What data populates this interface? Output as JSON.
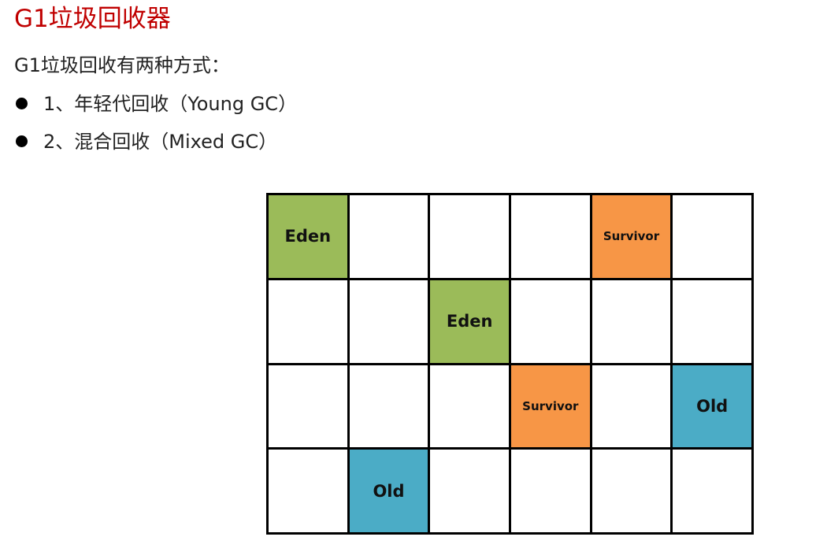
{
  "title": "G1垃圾回收器",
  "intro": "G1垃圾回收有两种方式：",
  "bullets": [
    "1、年轻代回收（Young GC）",
    "2、混合回收（Mixed GC）"
  ],
  "grid": {
    "rows": 4,
    "cols": 6,
    "cells": [
      [
        "Eden",
        "",
        "",
        "",
        "Survivor",
        ""
      ],
      [
        "",
        "",
        "Eden",
        "",
        "",
        ""
      ],
      [
        "",
        "",
        "",
        "Survivor",
        "",
        "Old"
      ],
      [
        "",
        "Old",
        "",
        "",
        "",
        ""
      ]
    ]
  },
  "colors": {
    "title": "#c00000",
    "eden": "#9bbb59",
    "survivor": "#f79646",
    "old": "#4bacc6"
  }
}
